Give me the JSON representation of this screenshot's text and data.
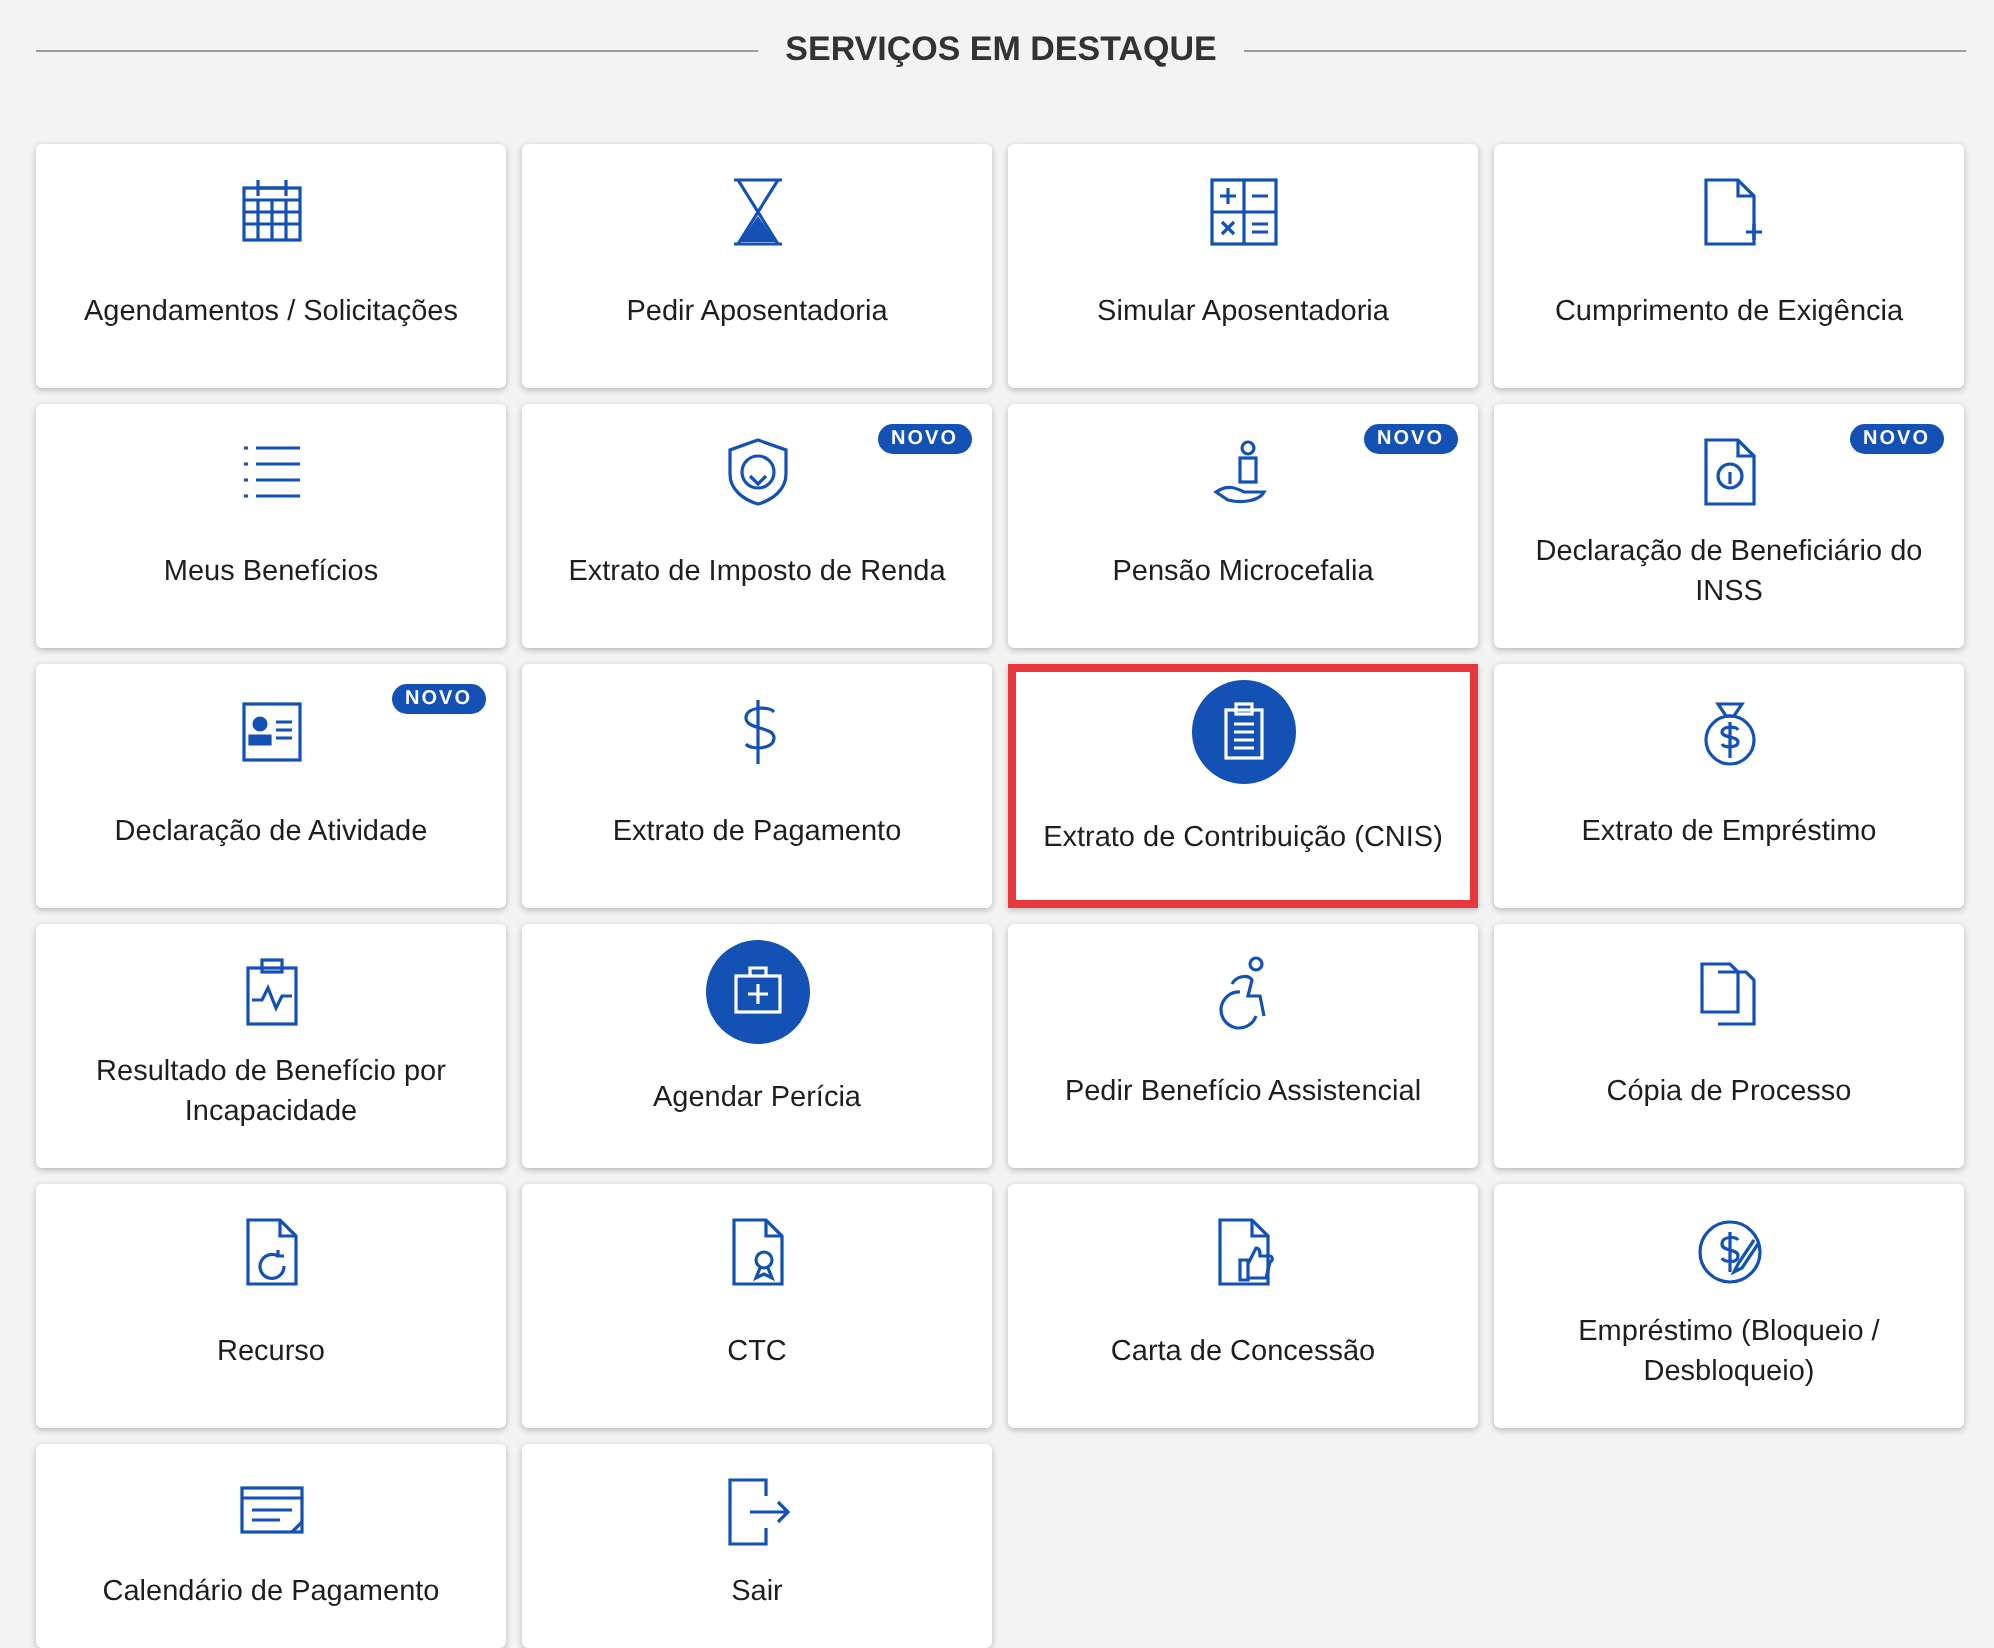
{
  "section_title": "SERVIÇOS EM DESTAQUE",
  "cards": [
    {
      "label": "Agendamentos / Solicitações",
      "kind": "outline",
      "highlighted": false
    },
    {
      "label": "Pedir Aposentadoria",
      "kind": "outline",
      "highlighted": false
    },
    {
      "label": "Simular Aposentadoria",
      "kind": "outline",
      "highlighted": false
    },
    {
      "label": "Cumprimento de Exigência",
      "kind": "outline",
      "highlighted": false
    },
    {
      "label": "Meus Benefícios",
      "kind": "outline",
      "highlighted": false
    },
    {
      "label": "Extrato de Imposto de Renda",
      "kind": "outline",
      "highlighted": false,
      "badge": "NOVO"
    },
    {
      "label": "Pensão Microcefalia",
      "kind": "outline",
      "highlighted": false,
      "badge": "NOVO"
    },
    {
      "label": "Declaração de Beneficiário do INSS",
      "kind": "outline",
      "highlighted": false,
      "badge": "NOVO"
    },
    {
      "label": "Declaração de Atividade",
      "kind": "outline",
      "highlighted": false,
      "badge": "NOVO"
    },
    {
      "label": "Extrato de Pagamento",
      "kind": "outline",
      "highlighted": false
    },
    {
      "label": "Extrato de Contribuição (CNIS)",
      "kind": "circle",
      "highlighted": true
    },
    {
      "label": "Extrato de Empréstimo",
      "kind": "outline",
      "highlighted": false
    },
    {
      "label": "Resultado de Benefício por Incapacidade",
      "kind": "outline",
      "highlighted": false
    },
    {
      "label": "Agendar Perícia",
      "kind": "circle",
      "highlighted": false
    },
    {
      "label": "Pedir Benefício Assistencial",
      "kind": "outline",
      "highlighted": false
    },
    {
      "label": "Cópia de Processo",
      "kind": "outline",
      "highlighted": false
    },
    {
      "label": "Recurso",
      "kind": "outline",
      "highlighted": false
    },
    {
      "label": "CTC",
      "kind": "outline",
      "highlighted": false
    },
    {
      "label": "Carta de Concessão",
      "kind": "outline",
      "highlighted": false
    },
    {
      "label": "Empréstimo (Bloqueio / Desbloqueio)",
      "kind": "outline",
      "highlighted": false
    },
    {
      "label": "Calendário de Pagamento",
      "kind": "outline",
      "highlighted": false
    },
    {
      "label": "Sair",
      "kind": "outline",
      "highlighted": false
    }
  ]
}
